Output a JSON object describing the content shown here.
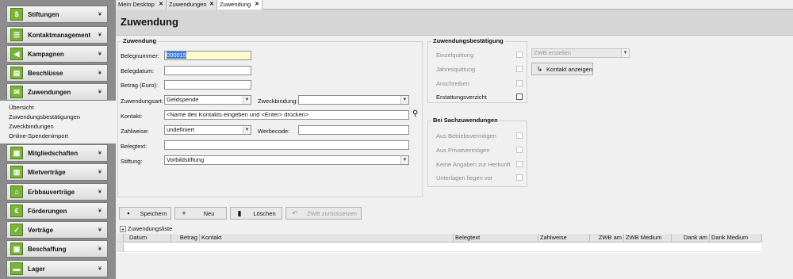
{
  "sidebar": {
    "items": [
      {
        "label": "Stiftungen",
        "icon": "foundation-icon",
        "glyph": "$"
      },
      {
        "label": "Kontaktmanagement",
        "icon": "contacts-icon",
        "glyph": "☰"
      },
      {
        "label": "Kampagnen",
        "icon": "megaphone-icon",
        "glyph": "◀"
      },
      {
        "label": "Beschlüsse",
        "icon": "resolution-icon",
        "glyph": "▤"
      },
      {
        "label": "Zuwendungen",
        "icon": "donation-icon",
        "glyph": "✉"
      },
      {
        "label": "Mitgliedschaften",
        "icon": "membership-icon",
        "glyph": "▦"
      },
      {
        "label": "Mietverträge",
        "icon": "rental-icon",
        "glyph": "▥"
      },
      {
        "label": "Erbbauverträge",
        "icon": "lease-icon",
        "glyph": "⌂"
      },
      {
        "label": "Förderungen",
        "icon": "funding-icon",
        "glyph": "€"
      },
      {
        "label": "Verträge",
        "icon": "contract-icon",
        "glyph": "✓"
      },
      {
        "label": "Beschaffung",
        "icon": "procurement-icon",
        "glyph": "▣"
      },
      {
        "label": "Lager",
        "icon": "warehouse-icon",
        "glyph": "▬"
      }
    ],
    "subitems": [
      "Übersicht",
      "Zuwendungsbestätigungen",
      "Zweckbindungen",
      "Online-Spendenimport"
    ],
    "chevron": "¥"
  },
  "tabs": [
    {
      "label": "Mein Desktop"
    },
    {
      "label": "Zuwendungen"
    },
    {
      "label": "Zuwendung"
    }
  ],
  "tab_close": "✕",
  "page": {
    "title": "Zuwendung"
  },
  "form": {
    "group_title": "Zuwendung",
    "belegnummer_label": "Belegnummer:",
    "belegnummer_value": "000015",
    "belegdatum_label": "Belegdatum:",
    "belegdatum_value": "",
    "betrag_label": "Betrag (Euro):",
    "betrag_value": "",
    "zuwendungsart_label": "Zuwendungsart:",
    "zuwendungsart_value": "Geldspende",
    "zweckbindung_label": "Zweckbindung:",
    "zweckbindung_value": "",
    "kontakt_label": "Kontakt:",
    "kontakt_value": "<Name des Kontakts eingeben und <Enter> drücken>",
    "zahlweise_label": "Zahlweise:",
    "zahlweise_value": "undefiniert",
    "werbecode_label": "Werbecode:",
    "werbecode_value": "",
    "belegtext_label": "Belegtext:",
    "belegtext_value": "",
    "stiftung_label": "Stiftung:",
    "stiftung_value": "Vorbildstiftung"
  },
  "zwb": {
    "group_title": "Zuwendungsbestätigung",
    "einzelquittung": "Einzelquittung",
    "jahresquittung": "Jahresquittung",
    "anschreiben": "Anschreiben",
    "erstattungsverzicht": "Erstattungsverzicht",
    "zwb_erstellen": "ZWB erstellen",
    "kontakt_anzeigen": "Kontakt anzeigen"
  },
  "sach": {
    "group_title": "Bei Sachzuwendungen",
    "betriebsvermoegen": "Aus Betriebsvermögen",
    "privatvermoegen": "Aus Privatvermögen",
    "keine_angaben": "Keine Angaben zur Herkunft",
    "unterlagen": "Unterlagen liegen vor"
  },
  "actions": {
    "speichern": "Speichern",
    "neu": "Neu",
    "loeschen": "Löschen",
    "zwb_zuruecksetzen": "ZWB zurücksetzen"
  },
  "list": {
    "title": "Zuwendungsliste",
    "columns": [
      "Datum",
      "Betrag",
      "Kontakt",
      "Belegtext",
      "Zahlweise",
      "ZWB am",
      "ZWB Medium",
      "Dank am",
      "Dank Medium"
    ]
  },
  "colors": {
    "accent_green": "#7ab33a",
    "highlight": "#fffbd0",
    "selection": "#3b78d8"
  }
}
